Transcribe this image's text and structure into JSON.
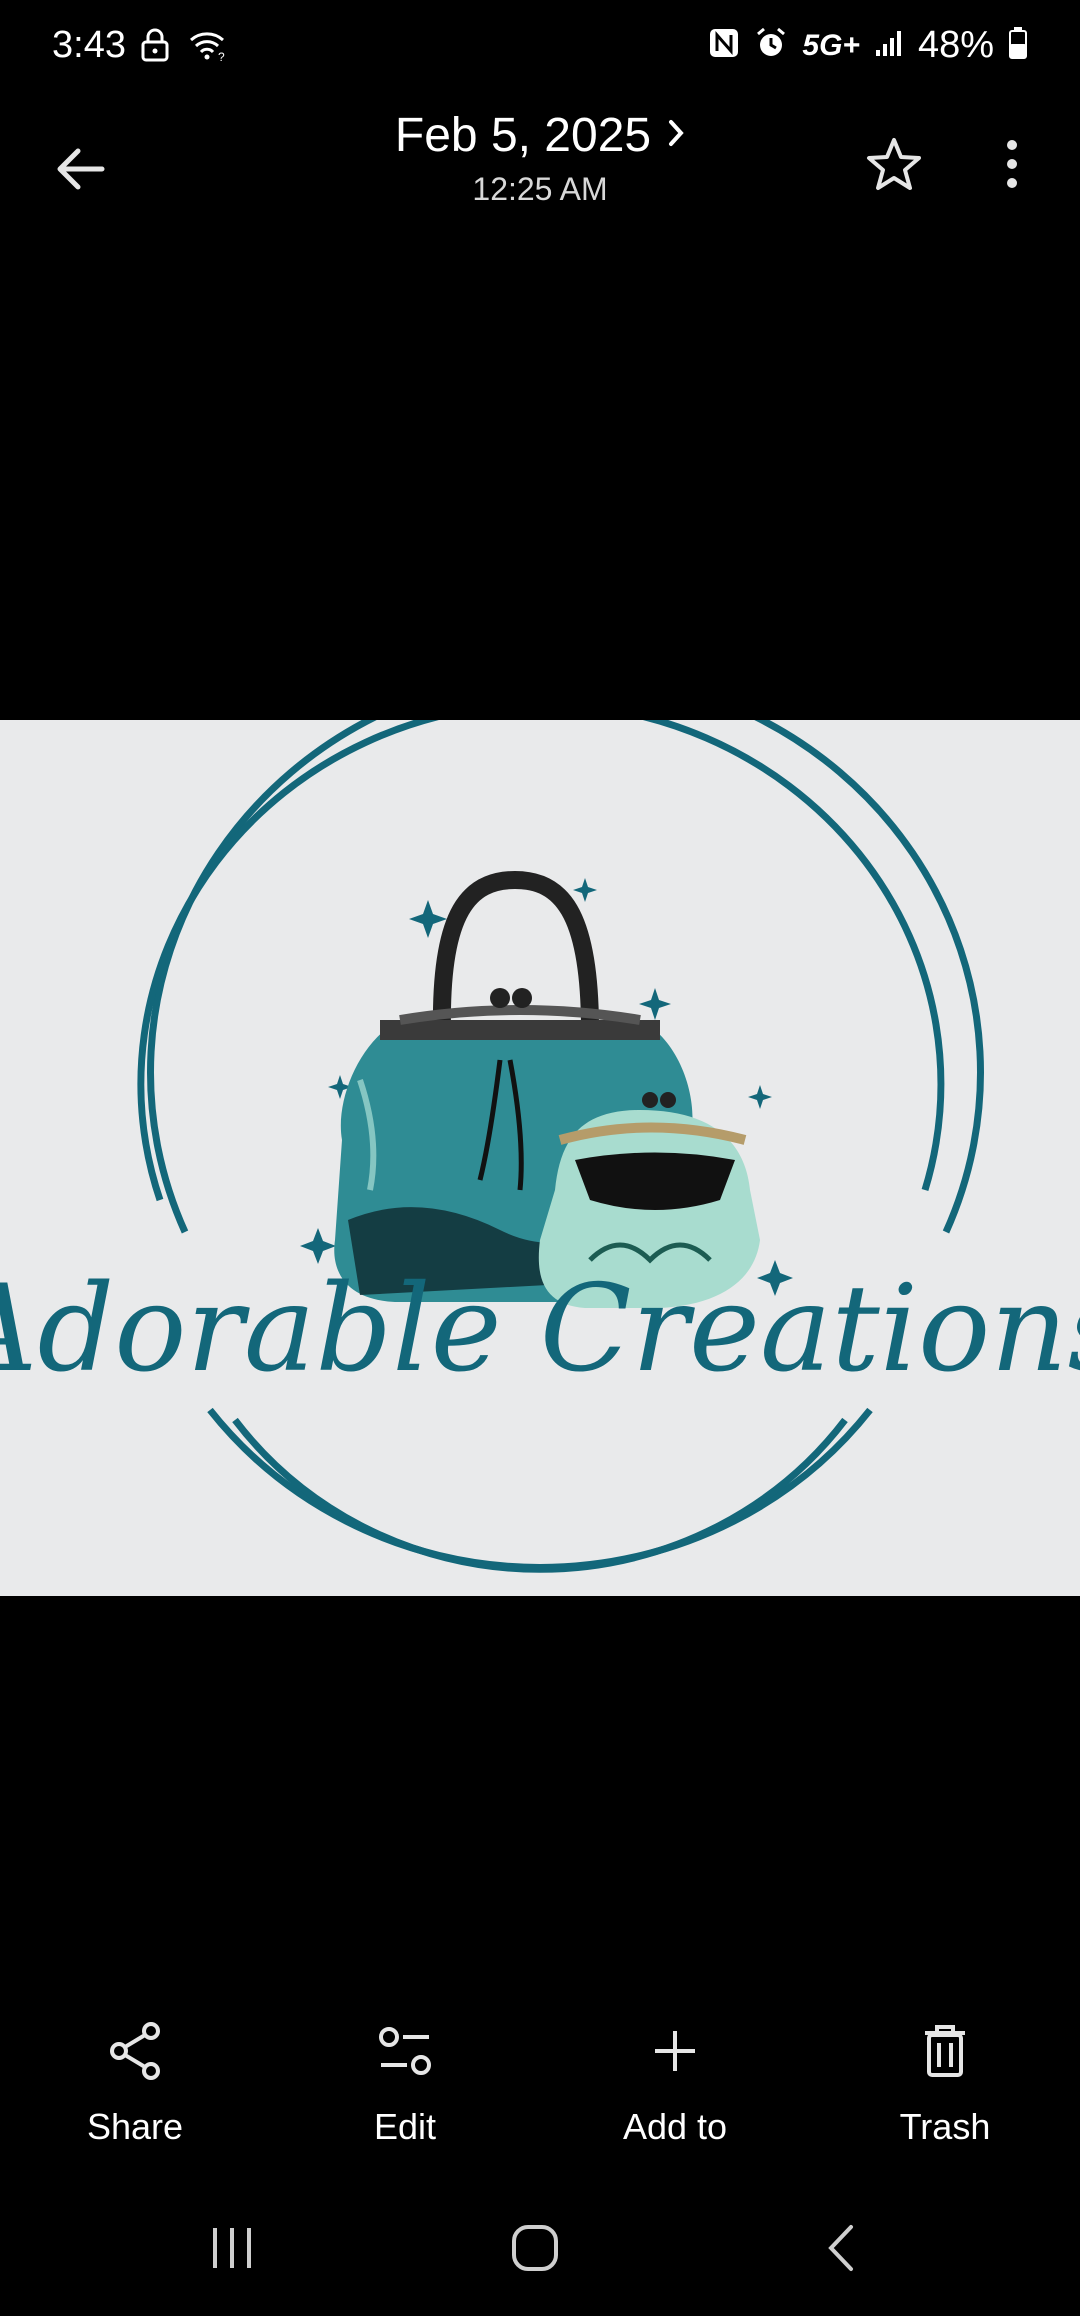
{
  "status_bar": {
    "time": "3:43",
    "network": "5G+",
    "battery": "48%",
    "icons": [
      "lock-icon",
      "wifi-icon",
      "nfc-icon",
      "alarm-icon",
      "signal-icon",
      "battery-icon"
    ]
  },
  "header": {
    "date": "Feb 5, 2025",
    "time": "12:25 AM",
    "icons": [
      "back-arrow-icon",
      "chevron-right-icon",
      "star-icon",
      "more-vert-icon"
    ]
  },
  "photo": {
    "logo_text": "Adorable Creations",
    "colors": {
      "ring": "#13677a",
      "background": "#e9eaeb",
      "bag_teal": "#3f9aa0",
      "bag_light": "#a8dccf"
    }
  },
  "actions": [
    {
      "label": "Share",
      "icon": "share-icon"
    },
    {
      "label": "Edit",
      "icon": "edit-sliders-icon"
    },
    {
      "label": "Add to",
      "icon": "plus-icon"
    },
    {
      "label": "Trash",
      "icon": "trash-icon"
    }
  ],
  "nav": [
    "recents-icon",
    "home-icon",
    "back-icon"
  ]
}
